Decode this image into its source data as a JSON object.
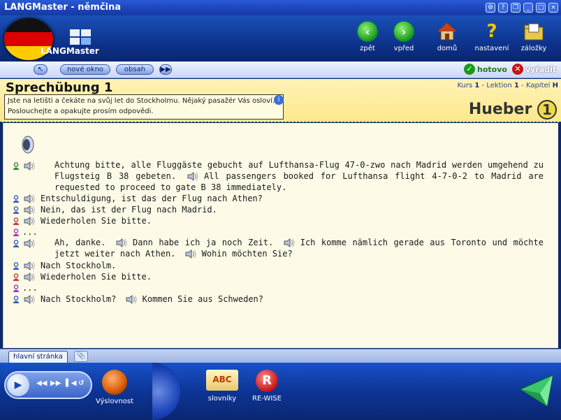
{
  "window": {
    "title": "LANGMaster - němčina"
  },
  "brand": {
    "logo_text": "LANGMaster"
  },
  "nav": [
    {
      "label": "zpět",
      "icon": "back-arrow-icon"
    },
    {
      "label": "vpřed",
      "icon": "forward-arrow-icon"
    },
    {
      "label": "domů",
      "icon": "home-icon"
    },
    {
      "label": "nastavení",
      "icon": "help-question-icon"
    },
    {
      "label": "záložky",
      "icon": "folder-icon"
    }
  ],
  "toolbar": {
    "new_window": "nové okno",
    "contents": "obsah",
    "done": "hotovo",
    "evaluate": "vyřadit"
  },
  "lesson": {
    "title": "Sprechübung 1",
    "instruction": "Jste na letišti a čekáte na svůj let do Stockholmu. Nějaký pasažér Vás osloví. Poslouchejte a opakujte prosím odpovědi.",
    "crumbs": {
      "kurs_label": "Kurs",
      "kurs": "1",
      "lektion_label": "Lektion",
      "lektion": "1",
      "kapitel_label": "Kapitel",
      "kapitel": "H"
    },
    "publisher": "Hueber",
    "publisher_badge": "1"
  },
  "dialogue": {
    "announcement_de": "Achtung bitte, alle Fluggäste gebucht auf Lufthansa-Flug 47-0-zwo nach Madrid werden umgehend zu Flugsteig B 38 gebeten.",
    "announcement_en": "All passengers booked for Lufthansa flight 4-7-0-2 to Madrid are requested to proceed to gate B 38 immediately.",
    "lines": [
      {
        "text": "Entschuldigung, ist das der Flug nach Athen?",
        "speaker": "blue"
      },
      {
        "text": "Nein, das ist der Flug nach Madrid.",
        "speaker": "blue"
      },
      {
        "text": "Wiederholen Sie bitte.",
        "speaker": "red"
      },
      {
        "text": "...",
        "speaker": "purple"
      }
    ],
    "line_ah_1": "Ah, danke.",
    "line_ah_2": "Dann habe ich ja noch Zeit.",
    "line_ah_3": "Ich komme nämlich gerade aus Toronto und möchte jetzt weiter nach Athen.",
    "line_ah_4": "Wohin möchten Sie?",
    "lines2": [
      {
        "text": "Nach Stockholm.",
        "speaker": "blue"
      },
      {
        "text": "Wiederholen Sie bitte.",
        "speaker": "red"
      },
      {
        "text": "...",
        "speaker": "purple"
      }
    ],
    "last_1": "Nach Stockholm?",
    "last_2": "Kommen Sie aus Schweden?"
  },
  "tabs": {
    "main": "hlavní stránka"
  },
  "bottom": {
    "pronunciation": "Výslovnost",
    "dictionaries": "slovníky",
    "rewise": "RE-WISE",
    "abc": "ABC",
    "rewise_letter": "R"
  },
  "colors": {
    "accent_blue": "#1b43b8",
    "lesson_yellow": "#fde88a",
    "done_green": "#1c9a1c",
    "evaluate_red": "#c81414"
  }
}
